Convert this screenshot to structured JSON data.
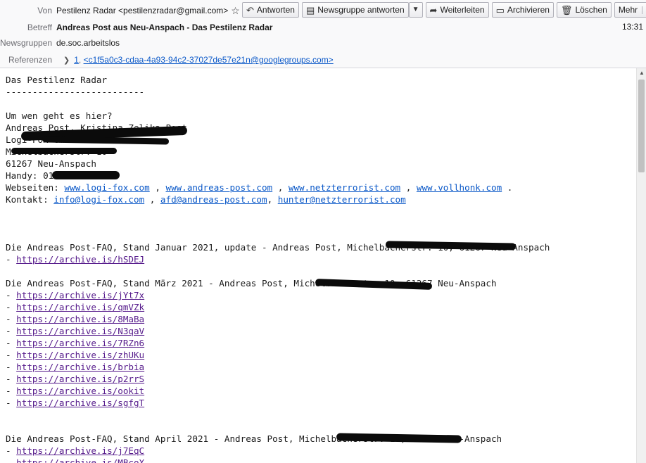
{
  "header": {
    "from_label": "Von",
    "from_value": "Pestilenz Radar <pestilenzradar@gmail.com>",
    "subject_label": "Betreff",
    "subject_value": "Andreas Post aus Neu-Anspach - Das Pestilenz Radar",
    "time": "13:31",
    "newsgroups_label": "Newsgruppen",
    "newsgroups_value": "de.soc.arbeitslos",
    "references_label": "Referenzen",
    "references_index": "1",
    "references_value": "<c1f5a0c3-cdaa-4a93-94c2-37027de57e21n@googlegroups.com>"
  },
  "toolbar": {
    "reply": "Antworten",
    "reply_group": "Newsgruppe antworten",
    "forward": "Weiterleiten",
    "archive": "Archivieren",
    "delete": "Löschen",
    "more": "Mehr"
  },
  "body": {
    "title": "Das Pestilenz Radar",
    "rule": "--------------------------",
    "question": "Um wen geht es hier?",
    "name_line": "Andreas Post, Kristina Zelika Post",
    "company": "Logi-Fox GmbH",
    "street": "Michelbacherstr. 10",
    "city": "61267 Neu-Anspach",
    "phone_prefix": "Handy: 017",
    "web_label": "Webseiten: ",
    "web_links": [
      "www.logi-fox.com",
      "www.andreas-post.com",
      "www.netzterrorist.com",
      "www.vollhonk.com"
    ],
    "contact_label": "Kontakt: ",
    "contact_links": [
      "info@logi-fox.com",
      "afd@andreas-post.com",
      "hunter@netzterrorist.com"
    ],
    "faq1": "Die Andreas Post-FAQ, Stand Januar 2021, update - Andreas Post, Michelbacherstr. 10, 61267 Neu-Anspach",
    "faq1_links": [
      "https://archive.is/hSDEJ"
    ],
    "faq2": "Die Andreas Post-FAQ, Stand März 2021 - Andreas Post, Michelbacherstr. 10, 61267 Neu-Anspach",
    "faq2_links": [
      "https://archive.is/jYt7x",
      "https://archive.is/qmVZk",
      "https://archive.is/8MaBa",
      "https://archive.is/N3qaV",
      "https://archive.is/7RZn6",
      "https://archive.is/zhUKu",
      "https://archive.is/brbia",
      "https://archive.is/p2rrS",
      "https://archive.is/ookit",
      "https://archive.is/sgfgT"
    ],
    "faq3": "Die Andreas Post-FAQ, Stand April 2021 - Andreas Post, Michelbacherstr. 10, 61267 Neu-Anspach",
    "faq3_links": [
      "https://archive.is/j7EqC",
      "https://archive.is/MBcoX"
    ]
  }
}
